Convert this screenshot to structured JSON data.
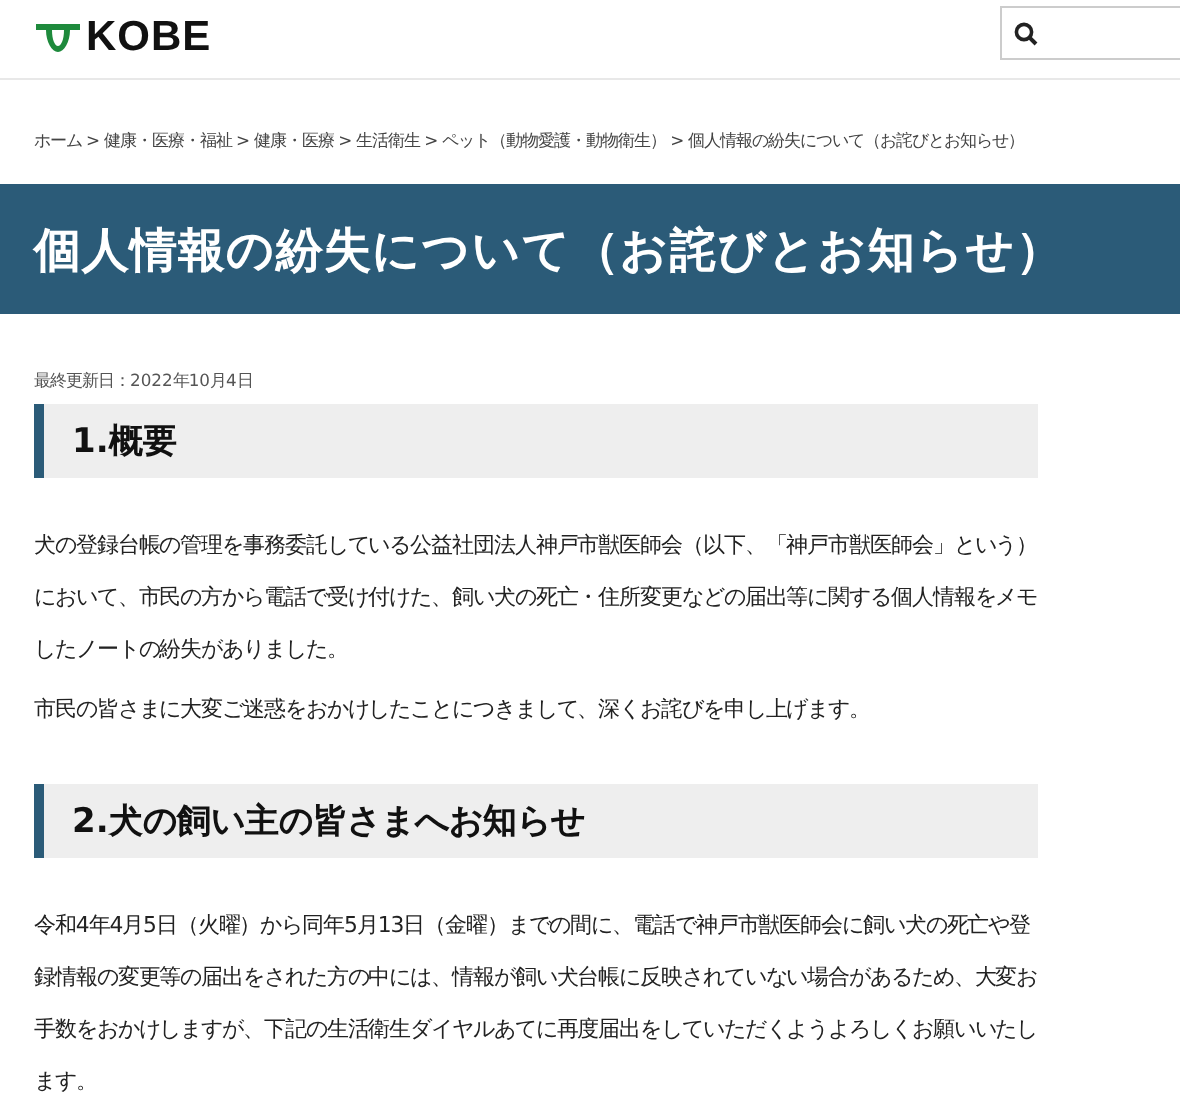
{
  "header": {
    "logo_text": "KOBE"
  },
  "breadcrumb": [
    "ホーム",
    "健康・医療・福祉",
    "健康・医療",
    "生活衛生",
    "ペット（動物愛護・動物衛生）",
    "個人情報の紛失について（お詫びとお知らせ）"
  ],
  "breadcrumb_separator": ">",
  "page_title": "個人情報の紛失について（お詫びとお知らせ）",
  "last_updated": "最終更新日：2022年10月4日",
  "sections": [
    {
      "heading": "1.概要",
      "paragraphs": [
        "犬の登録台帳の管理を事務委託している公益社団法人神戸市獣医師会（以下、「神戸市獣医師会」という）において、市民の方から電話で受け付けた、飼い犬の死亡・住所変更などの届出等に関する個人情報をメモしたノートの紛失がありました。",
        "市民の皆さまに大変ご迷惑をおかけしたことにつきまして、深くお詫びを申し上げます。"
      ]
    },
    {
      "heading": "2.犬の飼い主の皆さまへお知らせ",
      "paragraphs": [
        "令和4年4月5日（火曜）から同年5月13日（金曜）までの間に、電話で神戸市獣医師会に飼い犬の死亡や登録情報の変更等の届出をされた方の中には、情報が飼い犬台帳に反映されていない場合があるため、大変お手数をおかけしますが、下記の生活衛生ダイヤルあてに再度届出をしていただくようよろしくお願いいたします。"
      ]
    }
  ]
}
